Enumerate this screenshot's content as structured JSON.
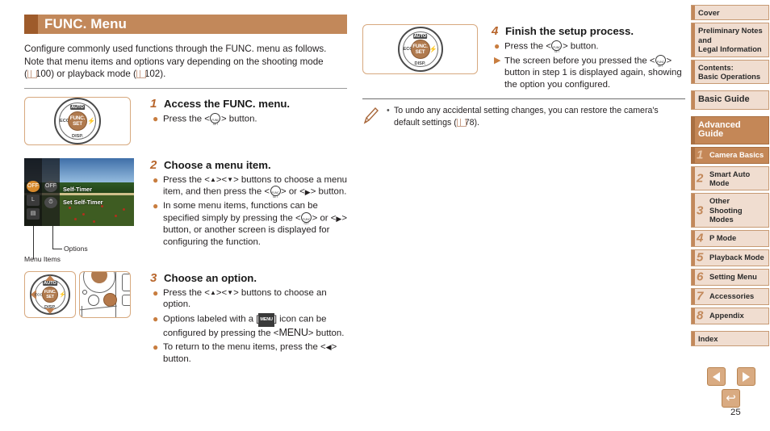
{
  "header": {
    "title": "FUNC. Menu"
  },
  "intro": {
    "line1": "Configure commonly used functions through the FUNC. menu as follows.",
    "line2": "Note that menu items and options vary depending on the shooting mode",
    "ref1": "100",
    "mid": ") or playback mode (",
    "ref2": "102",
    "tail": ")."
  },
  "steps": [
    {
      "number": "1",
      "title": "Access the FUNC. menu.",
      "bullets": [
        {
          "type": "dot",
          "pre": "Press the <",
          "icon": "func-set-icon",
          "post": "> button."
        }
      ]
    },
    {
      "number": "2",
      "title": "Choose a menu item.",
      "bullets": [
        {
          "type": "dot",
          "text": "Press the <▲><▼> buttons to choose a menu item, and then press the <FUNC/SET> or <▶> button."
        },
        {
          "type": "dot",
          "text": "In some menu items, functions can be specified simply by pressing the <FUNC/SET> or <▶> button, or another screen is displayed for configuring the function."
        }
      ]
    },
    {
      "number": "3",
      "title": "Choose an option.",
      "bullets": [
        {
          "type": "dot",
          "text": "Press the <▲><▼> buttons to choose an option."
        },
        {
          "type": "dot",
          "text": "Options labeled with a [MENU] icon can be configured by pressing the <MENU> button."
        },
        {
          "type": "dot",
          "text": "To return to the menu items, press the <◀> button."
        }
      ]
    },
    {
      "number": "4",
      "title": "Finish the setup process.",
      "bullets": [
        {
          "type": "dot",
          "text": "Press the <FUNC/SET> button."
        },
        {
          "type": "tri",
          "text": "The screen before you pressed the <FUNC/SET> button in step 1 is displayed again, showing the option you configured."
        }
      ]
    }
  ],
  "lcd": {
    "label_top": "Self-Timer",
    "label_bottom": "Set Self-Timer",
    "menu_items_caption": "Menu Items",
    "options_caption": "Options",
    "menu_item_1": "OFF",
    "menu_item_2": "L",
    "menu_item_3": "▤",
    "option_1": "OFF",
    "option_2": "⏱"
  },
  "dial": {
    "top_label": "AUTO",
    "bottom_label": "DISP.",
    "left_label": "ECO",
    "right_label": "⚡",
    "hub_line1": "FUNC.",
    "hub_line2": "SET"
  },
  "note": {
    "icon": "pencil-icon",
    "text_part1": "To undo any accidental setting changes, you can restore the camera's default settings (",
    "ref": "78",
    "text_part2": ")."
  },
  "sidebar": {
    "items": [
      {
        "label": "Cover",
        "size": "sm",
        "active": false,
        "chapter": null
      },
      {
        "label": "Preliminary Notes and Legal Information",
        "size": "sm",
        "active": false,
        "chapter": null
      },
      {
        "label": "Contents:\nBasic Operations",
        "size": "sm",
        "active": false,
        "chapter": null
      },
      {
        "label": "Basic Guide",
        "size": "lg",
        "active": false,
        "chapter": null
      },
      {
        "label": "Advanced Guide",
        "size": "lg",
        "active": true,
        "chapter": null
      },
      {
        "label": "Camera Basics",
        "size": "sm",
        "active": true,
        "chapter": "1"
      },
      {
        "label": "Smart Auto Mode",
        "size": "sm",
        "active": false,
        "chapter": "2"
      },
      {
        "label": "Other Shooting Modes",
        "size": "sm",
        "active": false,
        "chapter": "3"
      },
      {
        "label": "P Mode",
        "size": "sm",
        "active": false,
        "chapter": "4"
      },
      {
        "label": "Playback Mode",
        "size": "sm",
        "active": false,
        "chapter": "5"
      },
      {
        "label": "Setting Menu",
        "size": "sm",
        "active": false,
        "chapter": "6"
      },
      {
        "label": "Accessories",
        "size": "sm",
        "active": false,
        "chapter": "7"
      },
      {
        "label": "Appendix",
        "size": "sm",
        "active": false,
        "chapter": "8"
      },
      {
        "label": "Index",
        "size": "sm",
        "active": false,
        "chapter": null
      }
    ]
  },
  "footer": {
    "prev_label": "◀",
    "next_label": "▶",
    "back_label": "↩",
    "page_number": "25"
  },
  "colors": {
    "accent_dark": "#9e5b2b",
    "accent": "#c2885a",
    "accent_light": "#f0ddd0",
    "bullet": "#c87d3f",
    "step_number": "#b8662c"
  }
}
